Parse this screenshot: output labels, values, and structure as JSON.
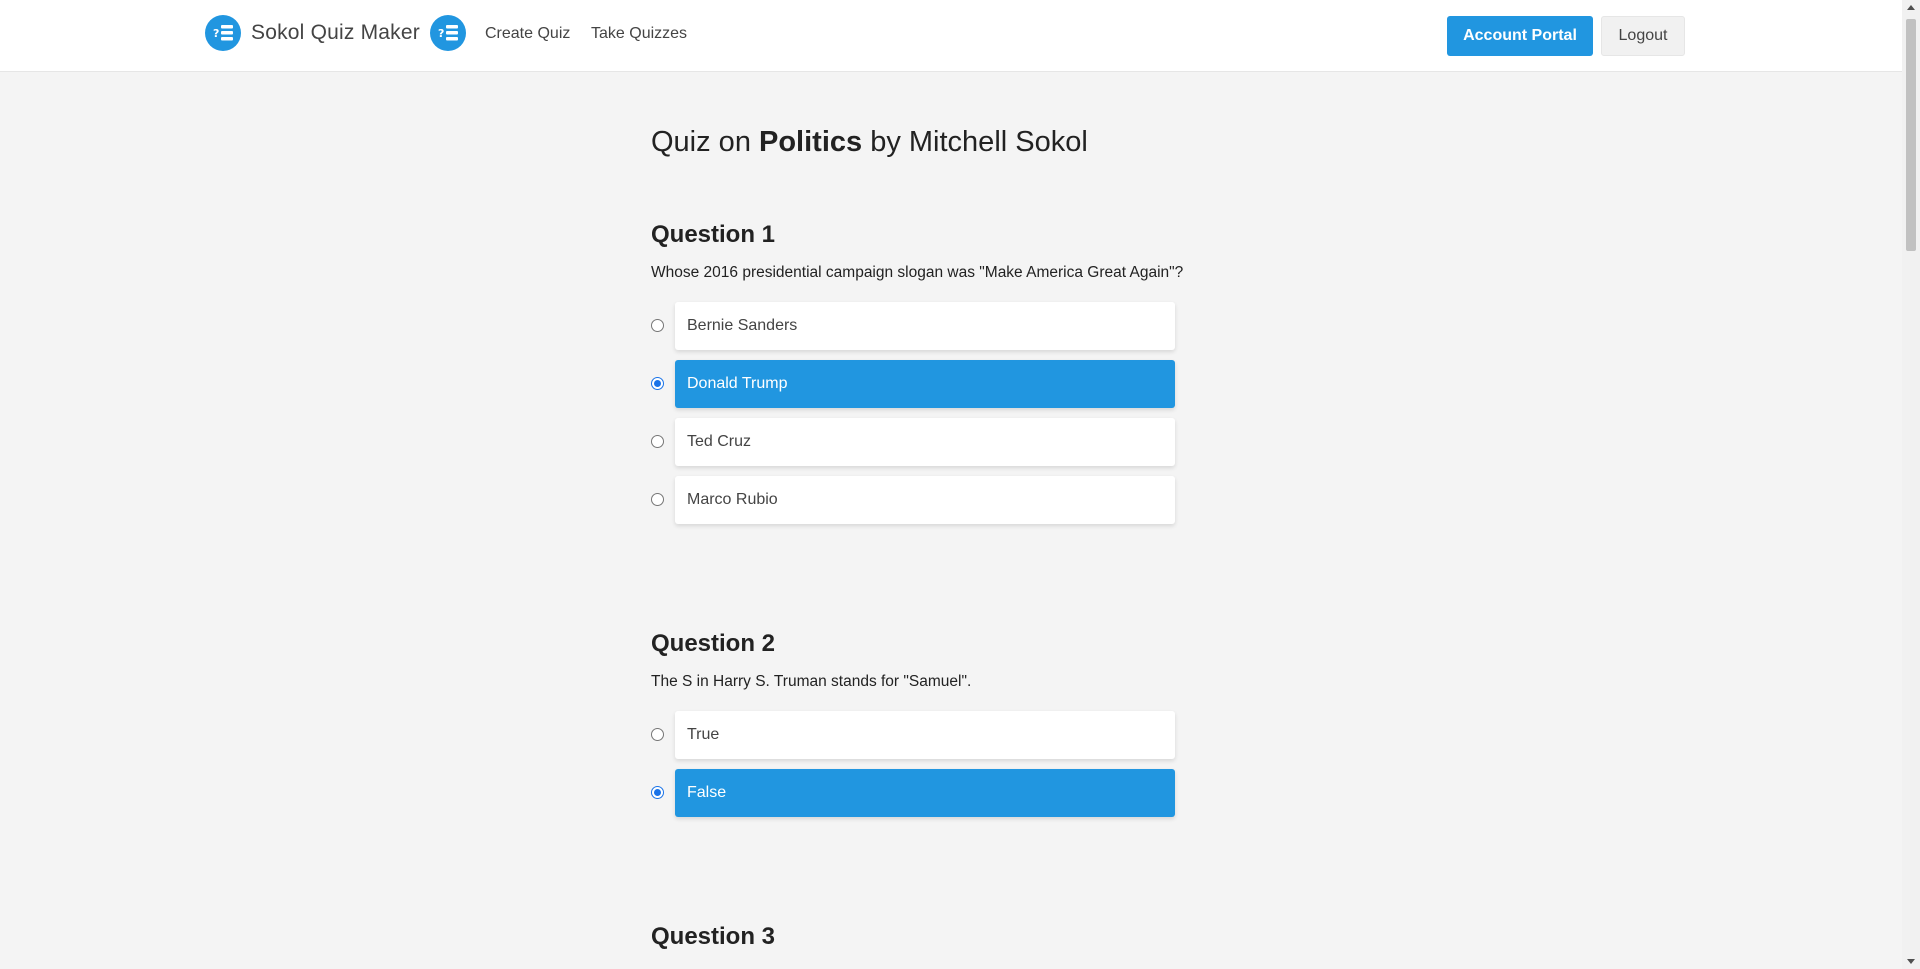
{
  "navbar": {
    "brand": "Sokol Quiz Maker",
    "links": [
      "Create Quiz",
      "Take Quizzes"
    ],
    "account_button": "Account Portal",
    "logout_button": "Logout"
  },
  "quiz": {
    "title_prefix": "Quiz on ",
    "topic": "Politics",
    "title_suffix": " by Mitchell Sokol"
  },
  "questions": [
    {
      "heading": "Question 1",
      "text": "Whose 2016 presidential campaign slogan was \"Make America Great Again\"?",
      "options": [
        "Bernie Sanders",
        "Donald Trump",
        "Ted Cruz",
        "Marco Rubio"
      ],
      "selected_option": "Donald Trump"
    },
    {
      "heading": "Question 2",
      "text": "The S in Harry S. Truman stands for \"Samuel\".",
      "options": [
        "True",
        "False"
      ],
      "selected_option": "False"
    },
    {
      "heading": "Question 3"
    }
  ],
  "colors": {
    "accent": "#2196e0",
    "background": "#f4f4f4",
    "radio_checked": "#1a73e8"
  },
  "icons": {
    "logo": "quiz-list-icon"
  }
}
